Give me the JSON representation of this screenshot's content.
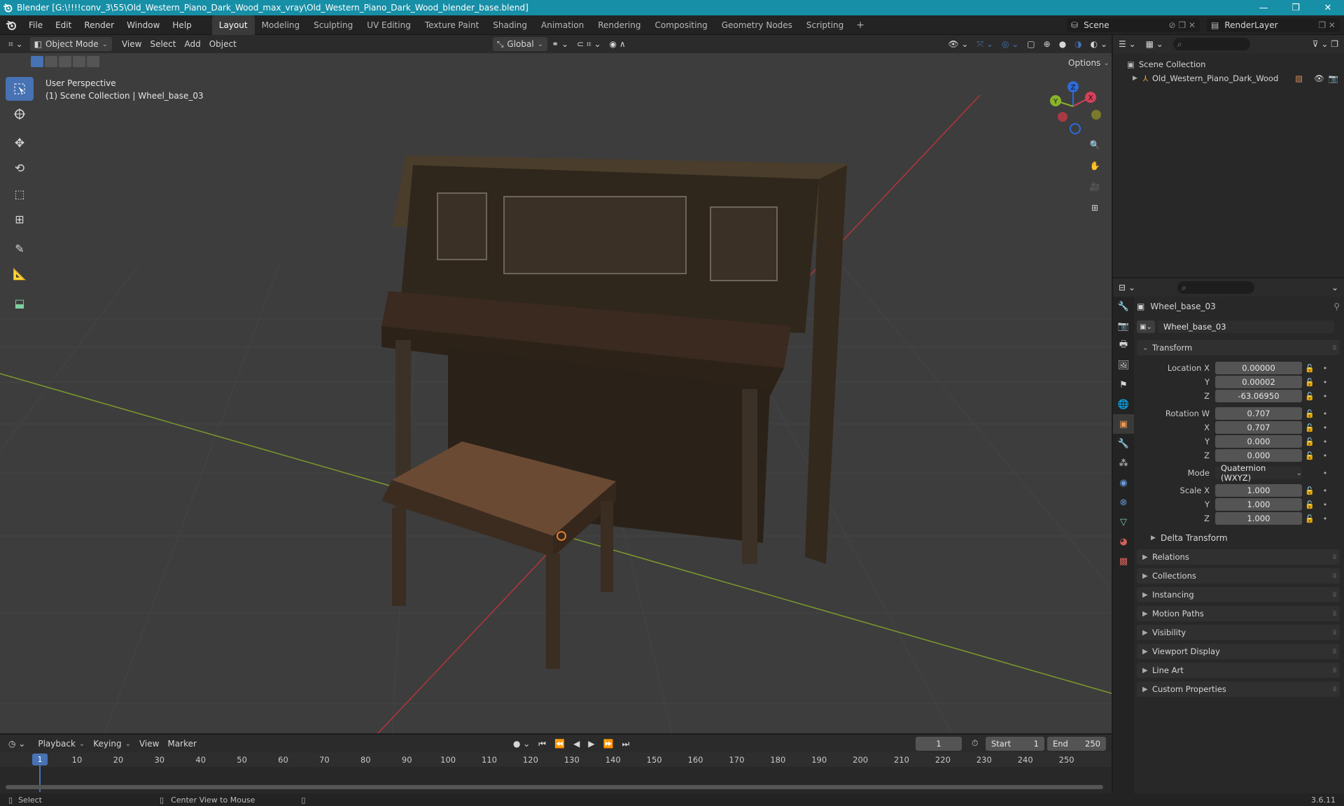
{
  "window": {
    "title": "Blender [G:\\!!!!conv_3\\55\\Old_Western_Piano_Dark_Wood_max_vray\\Old_Western_Piano_Dark_Wood_blender_base.blend]",
    "accent": "#178fa6"
  },
  "menu": {
    "items": [
      "File",
      "Edit",
      "Render",
      "Window",
      "Help"
    ]
  },
  "workspaces": {
    "tabs": [
      "Layout",
      "Modeling",
      "Sculpting",
      "UV Editing",
      "Texture Paint",
      "Shading",
      "Animation",
      "Rendering",
      "Compositing",
      "Geometry Nodes",
      "Scripting"
    ],
    "active": "Layout"
  },
  "scene": {
    "name": "Scene",
    "view_layer": "RenderLayer"
  },
  "viewport_header": {
    "mode": "Object Mode",
    "menus": [
      "View",
      "Select",
      "Add",
      "Object"
    ],
    "transform_orientation": "Global",
    "options": "Options"
  },
  "viewport": {
    "perspective": "User Perspective",
    "context": "(1) Scene Collection | Wheel_base_03",
    "gizmo": {
      "x": "X",
      "y": "Y",
      "z": "Z"
    }
  },
  "outliner": {
    "root": "Scene Collection",
    "items": [
      {
        "name": "Old_Western_Piano_Dark_Wood"
      }
    ]
  },
  "properties": {
    "object_name": "Wheel_base_03",
    "data_name": "Wheel_base_03",
    "transform_title": "Transform",
    "location": {
      "label": "Location X",
      "x": "0.00000",
      "y": "0.00002",
      "z": "-63.06950"
    },
    "rotation": {
      "label": "Rotation W",
      "w": "0.707",
      "x": "0.707",
      "y": "0.000",
      "z": "0.000"
    },
    "mode_label": "Mode",
    "mode_value": "Quaternion (WXYZ)",
    "scale": {
      "label": "Scale X",
      "x": "1.000",
      "y": "1.000",
      "z": "1.000"
    },
    "axis_labels": {
      "x": "X",
      "y": "Y",
      "z": "Z"
    },
    "delta": "Delta Transform",
    "panels": [
      "Relations",
      "Collections",
      "Instancing",
      "Motion Paths",
      "Visibility",
      "Viewport Display",
      "Line Art",
      "Custom Properties"
    ]
  },
  "timeline": {
    "menus": [
      "Playback",
      "Keying",
      "View",
      "Marker"
    ],
    "current_frame": "1",
    "start_label": "Start",
    "start": "1",
    "end_label": "End",
    "end": "250",
    "ruler": [
      "10",
      "20",
      "30",
      "40",
      "50",
      "60",
      "70",
      "80",
      "90",
      "100",
      "110",
      "120",
      "130",
      "140",
      "150",
      "160",
      "170",
      "180",
      "190",
      "200",
      "210",
      "220",
      "230",
      "240",
      "250"
    ],
    "cursor": "1"
  },
  "status": {
    "select": "Select",
    "center": "Center View to Mouse",
    "version": "3.6.11"
  }
}
